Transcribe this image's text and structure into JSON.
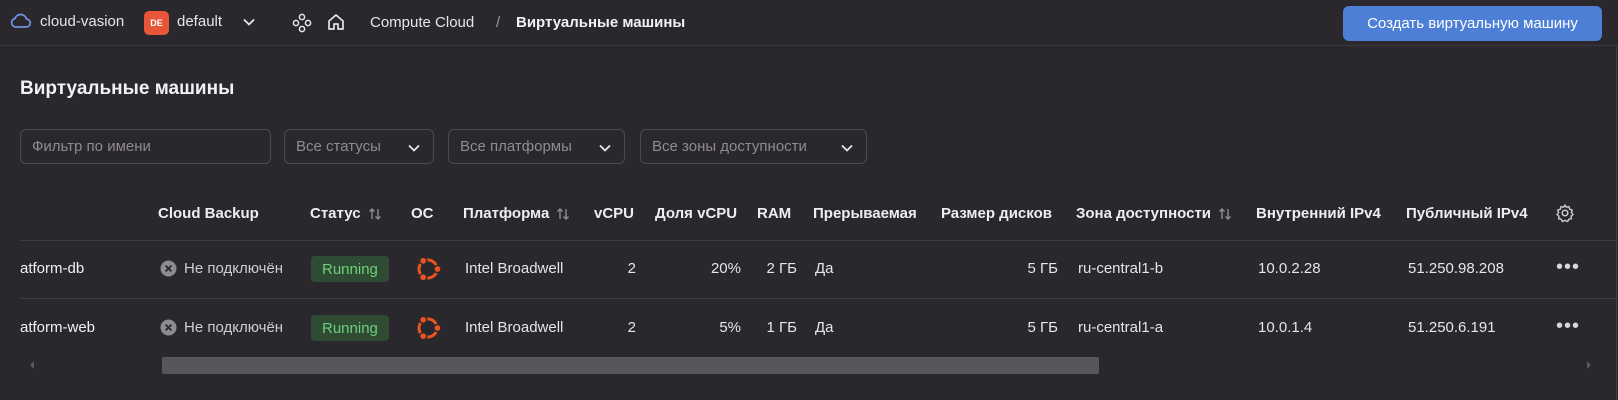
{
  "header": {
    "cloud_name": "cloud-vasion",
    "folder_badge": "DE",
    "folder_name": "default",
    "breadcrumb": [
      "Compute Cloud",
      "Виртуальные машины"
    ],
    "separator": "/",
    "create_button": "Создать виртуальную машину"
  },
  "page": {
    "title": "Виртуальные машины"
  },
  "filters": {
    "name_placeholder": "Фильтр по имени",
    "status": "Все статусы",
    "platform": "Все платформы",
    "zone": "Все зоны доступности"
  },
  "table": {
    "columns": {
      "backup": "Cloud Backup",
      "status": "Статус",
      "os": "ОС",
      "platform": "Платформа",
      "vcpu": "vCPU",
      "vcpu_share": "Доля vCPU",
      "ram": "RAM",
      "preemptible": "Прерываемая",
      "disks": "Размер дисков",
      "zone": "Зона доступности",
      "internal_ip": "Внутренний IPv4",
      "public_ip": "Публичный IPv4"
    },
    "rows": [
      {
        "name": "atform-db",
        "backup": "Не подключён",
        "status": "Running",
        "os_icon": "ubuntu-icon",
        "platform": "Intel Broadwell",
        "vcpu": "2",
        "vcpu_share": "20%",
        "ram": "2 ГБ",
        "preemptible": "Да",
        "disks": "5 ГБ",
        "zone": "ru-central1-b",
        "internal_ip": "10.0.2.28",
        "public_ip": "51.250.98.208"
      },
      {
        "name": "atform-web",
        "backup": "Не подключён",
        "status": "Running",
        "os_icon": "ubuntu-icon",
        "platform": "Intel Broadwell",
        "vcpu": "2",
        "vcpu_share": "5%",
        "ram": "1 ГБ",
        "preemptible": "Да",
        "disks": "5 ГБ",
        "zone": "ru-central1-a",
        "internal_ip": "10.0.1.4",
        "public_ip": "51.250.6.191"
      }
    ],
    "more_label": "•••"
  },
  "colors": {
    "background": "#2a282c",
    "accent": "#4d7fd6",
    "folder_badge": "#e8563a",
    "status_running_bg": "#2f4b34",
    "status_running_text": "#6fd07a",
    "ubuntu": "#e95420"
  }
}
